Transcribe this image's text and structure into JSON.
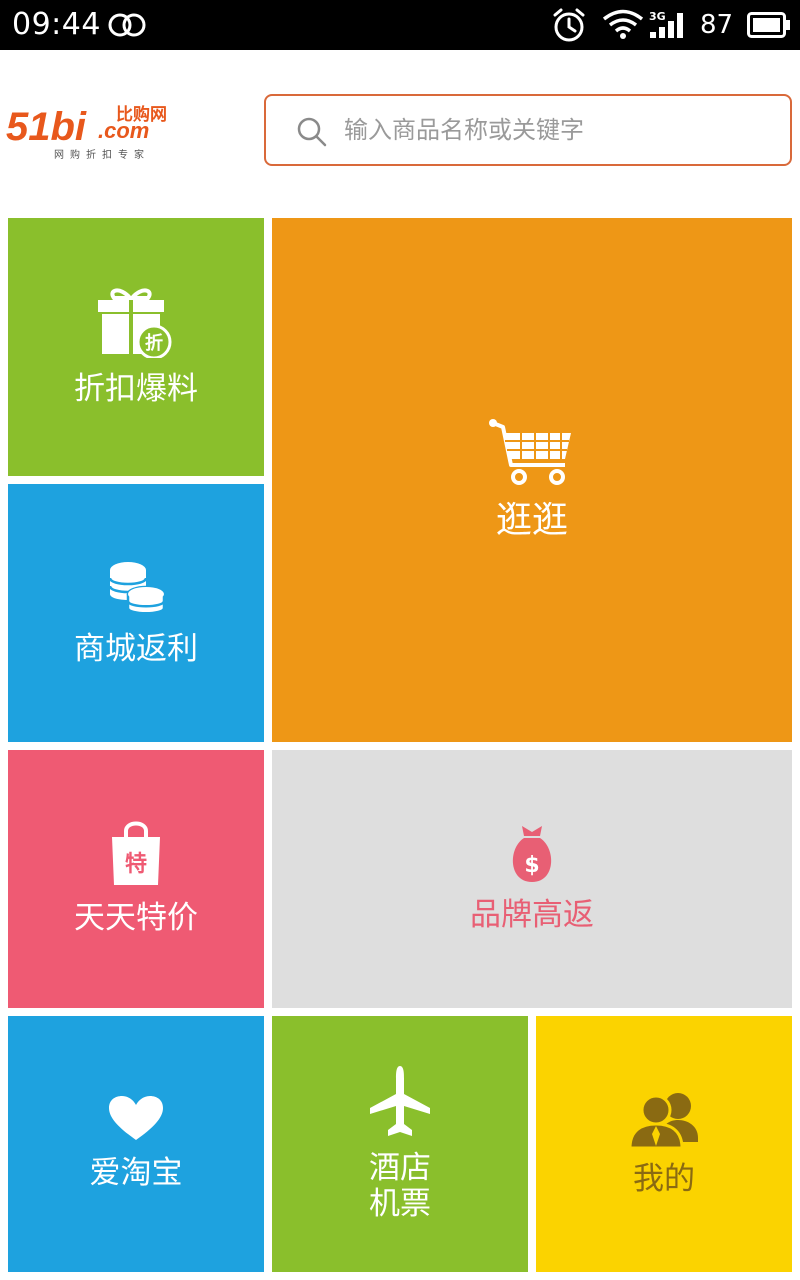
{
  "status_bar": {
    "time": "09:44",
    "network": "3G",
    "battery": "87"
  },
  "header": {
    "logo_text": "51bi",
    "logo_domain": ".com",
    "logo_cn": "比购网",
    "logo_tagline": "网购折扣专家",
    "search_placeholder": "输入商品名称或关键字"
  },
  "tiles": {
    "zhekou": {
      "label": "折扣爆料",
      "icon": "gift-discount-icon",
      "badge": "折",
      "color": "#8abf2c"
    },
    "shangcheng": {
      "label": "商城返利",
      "icon": "coins-icon",
      "color": "#1ea2df"
    },
    "guangguang": {
      "label": "逛逛",
      "icon": "shopping-cart-icon",
      "color": "#ee9716"
    },
    "tiantian": {
      "label": "天天特价",
      "icon": "shopping-bag-icon",
      "badge": "特",
      "color": "#ef5a73"
    },
    "pinpai": {
      "label": "品牌高返",
      "icon": "money-bag-icon",
      "badge": "$",
      "color": "#dedede"
    },
    "aitaobao": {
      "label": "爱淘宝",
      "icon": "heart-icon",
      "color": "#1ea2df"
    },
    "jiudian": {
      "label_line1": "酒店",
      "label_line2": "机票",
      "icon": "airplane-icon",
      "color": "#8abf2c"
    },
    "wode": {
      "label": "我的",
      "icon": "users-icon",
      "color": "#fbd300"
    }
  }
}
